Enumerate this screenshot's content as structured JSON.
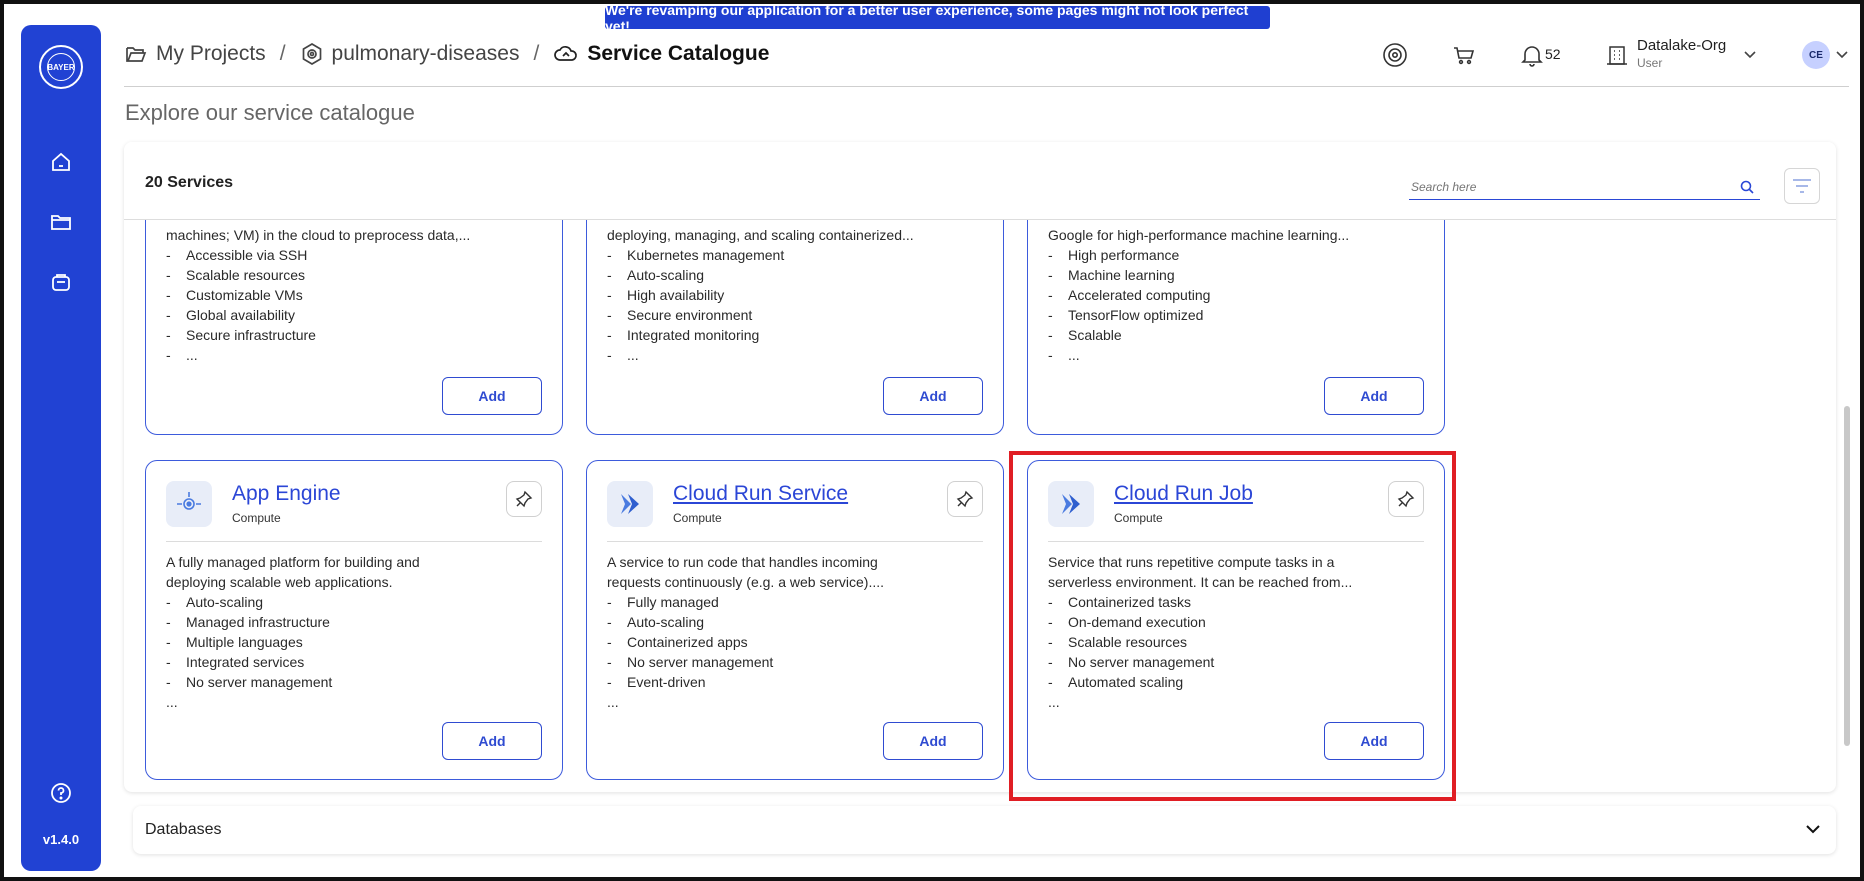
{
  "banner": {
    "text": "We're revamping our application for a better user experience, some pages might not look perfect yet!"
  },
  "sidebar": {
    "logo_text": "BAYER",
    "items": [
      {
        "icon": "home-icon"
      },
      {
        "icon": "folder-icon"
      },
      {
        "icon": "bag-icon"
      }
    ],
    "help_icon": "help-icon",
    "version": "v1.4.0"
  },
  "breadcrumb": {
    "items": [
      {
        "label": "My Projects",
        "icon": "folder-open-icon"
      },
      {
        "label": "pulmonary-diseases",
        "icon": "hexagon-gear-icon"
      },
      {
        "label": "Service Catalogue",
        "icon": "cloud-icon"
      }
    ],
    "separator": "/"
  },
  "header": {
    "notification_count": "52",
    "org_name": "Datalake-Org",
    "org_role": "User",
    "avatar_initials": "CE"
  },
  "page": {
    "title": "Explore our service catalogue",
    "service_count": "20 Services",
    "search_placeholder": "Search here"
  },
  "cards_top": [
    {
      "desc": "machines; VM) in the cloud to preprocess data,...",
      "features": [
        "Accessible via SSH",
        "Scalable resources",
        "Customizable VMs",
        "Global availability",
        "Secure infrastructure"
      ],
      "more": "...",
      "add_label": "Add"
    },
    {
      "desc": "deploying, managing, and scaling containerized...",
      "features": [
        "Kubernetes management",
        "Auto-scaling",
        "High availability",
        "Secure environment",
        "Integrated monitoring"
      ],
      "more": "...",
      "add_label": "Add"
    },
    {
      "desc": "Google for high-performance machine learning...",
      "features": [
        "High performance",
        "Machine learning",
        "Accelerated computing",
        "TensorFlow optimized",
        "Scalable"
      ],
      "more": "...",
      "add_label": "Add"
    }
  ],
  "cards_bottom": [
    {
      "title": "App Engine",
      "category": "Compute",
      "desc1": "A fully managed platform for building and",
      "desc2": "deploying scalable web applications.",
      "features": [
        "Auto-scaling",
        "Managed infrastructure",
        "Multiple languages",
        "Integrated services",
        "No server management"
      ],
      "more": "...",
      "add_label": "Add"
    },
    {
      "title": "Cloud Run Service",
      "category": "Compute",
      "desc1": "A service to run code that handles incoming",
      "desc2": "requests continuously (e.g. a web service)....",
      "features": [
        "Fully managed",
        "Auto-scaling",
        "Containerized apps",
        "No server management",
        "Event-driven"
      ],
      "more": "...",
      "add_label": "Add"
    },
    {
      "title": "Cloud Run Job",
      "category": "Compute",
      "desc1": "Service that runs repetitive compute tasks in a",
      "desc2": "serverless environment. It can be reached from...",
      "features": [
        "Containerized tasks",
        "On-demand execution",
        "Scalable resources",
        "No server management",
        "Automated scaling"
      ],
      "more": "...",
      "add_label": "Add"
    }
  ],
  "sections": {
    "databases_label": "Databases"
  },
  "colors": {
    "primary": "#2142d3",
    "highlight": "#e01e24",
    "link": "#2b46d6"
  }
}
